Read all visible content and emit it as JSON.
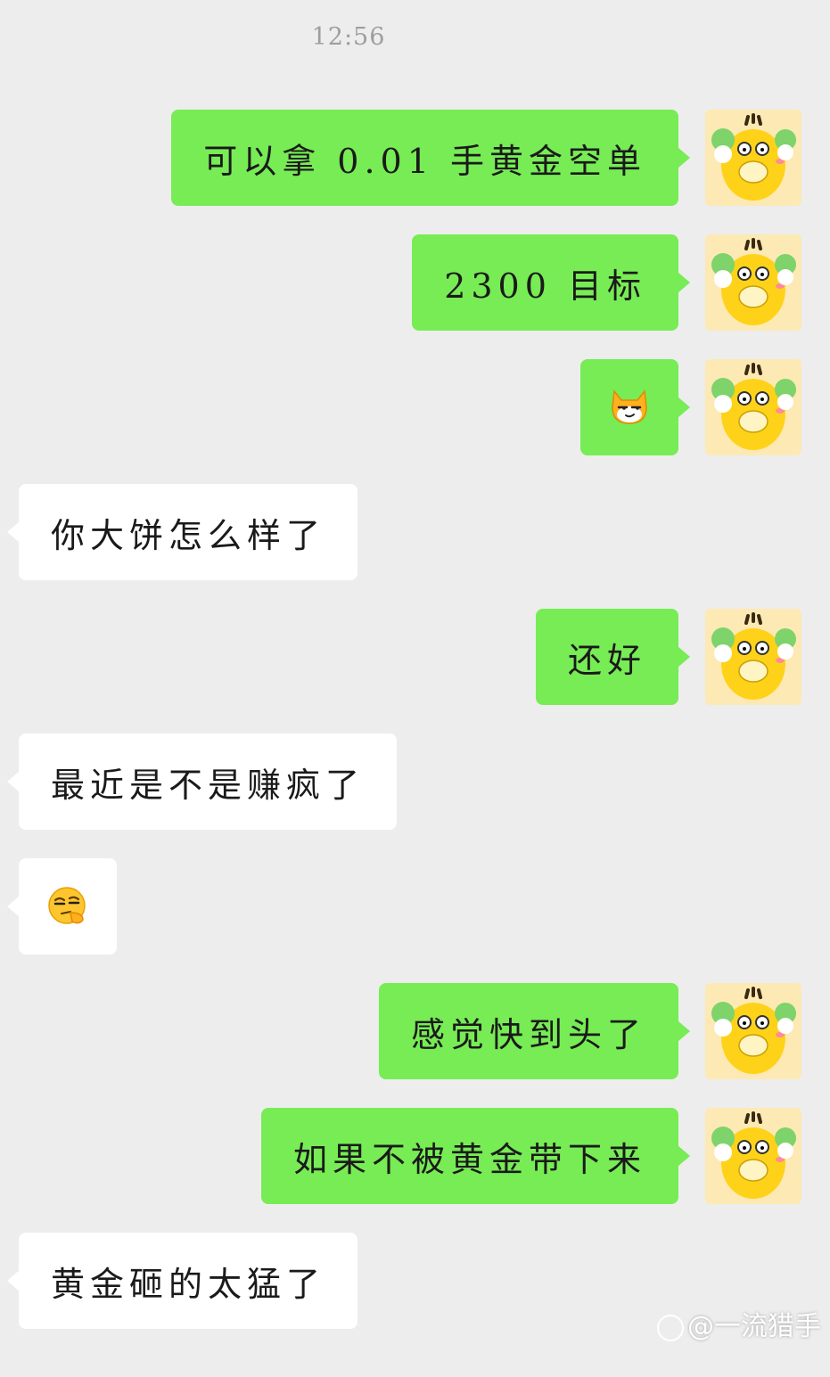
{
  "timestamp": "12:56",
  "messages": [
    {
      "side": "me",
      "text": "可以拿 0.01 手黄金空单"
    },
    {
      "side": "me",
      "text": "2300 目标"
    },
    {
      "side": "me",
      "emoji": "smirking-cat-emoji"
    },
    {
      "side": "other",
      "text": "你大饼怎么样了"
    },
    {
      "side": "me",
      "text": "还好"
    },
    {
      "side": "other",
      "text": "最近是不是赚疯了"
    },
    {
      "side": "other",
      "emoji": "thinking-squint-emoji"
    },
    {
      "side": "me",
      "text": "感觉快到头了"
    },
    {
      "side": "me",
      "text": "如果不被黄金带下来"
    },
    {
      "side": "other",
      "text": "黄金砸的太猛了"
    }
  ],
  "avatar": {
    "icon": "psyduck-cabbage-avatar"
  },
  "colors": {
    "my_bubble": "#77ec55",
    "other_bubble": "#ffffff",
    "background": "#ededed"
  },
  "watermark": "@一流猎手"
}
